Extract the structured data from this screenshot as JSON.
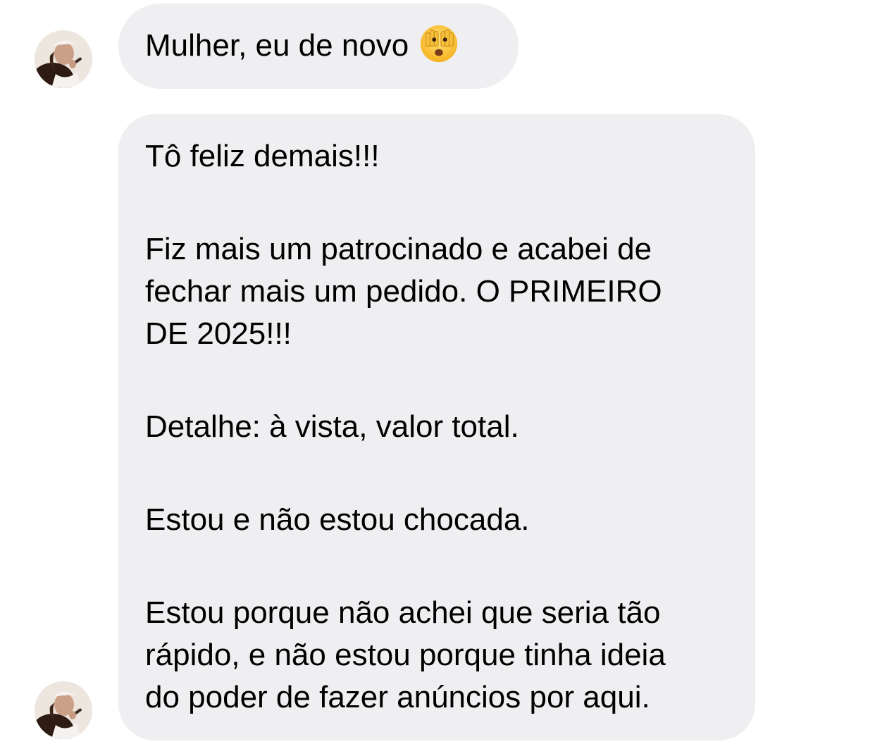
{
  "conversation": {
    "messages": [
      {
        "text": "Mulher, eu de novo",
        "emoji": "see-no-evil-face-peeking-icon"
      },
      {
        "paragraphs": [
          "Tô feliz demais!!!",
          "Fiz mais um patrocinado e acabei de\nfechar mais um pedido. O PRIMEIRO\nDE 2025!!!",
          "Detalhe: à vista, valor total.",
          "Estou e não estou chocada.",
          "Estou porque não achei que seria tão\nrápido, e não estou porque tinha ideia\ndo poder de fazer anúncios por aqui."
        ]
      }
    ],
    "colors": {
      "bubble_background": "#efeef1",
      "text": "#000000",
      "page_background": "#ffffff"
    }
  }
}
